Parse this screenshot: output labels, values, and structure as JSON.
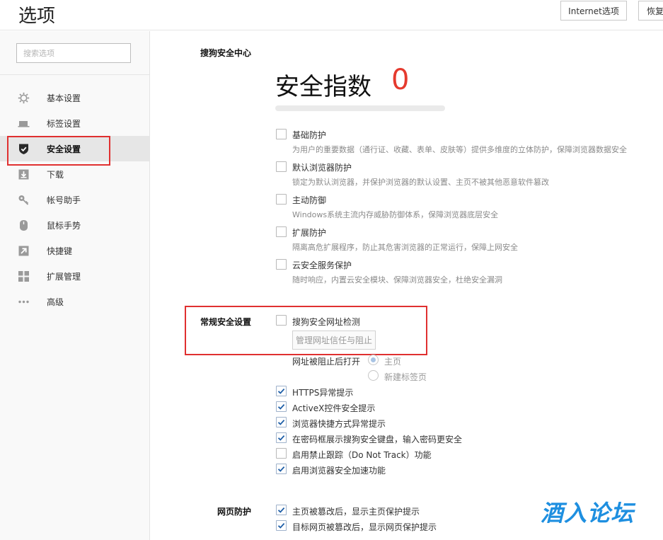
{
  "header": {
    "title": "选项",
    "internet_options": "Internet选项",
    "restore": "恢复"
  },
  "sidebar": {
    "search_placeholder": "搜索选项",
    "items": [
      {
        "label": "基本设置",
        "icon": "gear-icon"
      },
      {
        "label": "标签设置",
        "icon": "tab-icon"
      },
      {
        "label": "安全设置",
        "icon": "shield-icon",
        "active": true
      },
      {
        "label": "下载",
        "icon": "download-icon"
      },
      {
        "label": "帐号助手",
        "icon": "key-icon"
      },
      {
        "label": "鼠标手势",
        "icon": "mouse-icon"
      },
      {
        "label": "快捷键",
        "icon": "shortcut-arrow-icon"
      },
      {
        "label": "扩展管理",
        "icon": "extension-grid-icon"
      },
      {
        "label": "高级",
        "icon": "more-dots-icon"
      }
    ]
  },
  "security_center": {
    "section_title": "搜狗安全中心",
    "index_label": "安全指数",
    "score": "0",
    "score_progress": 0,
    "options": [
      {
        "title": "基础防护",
        "desc": "为用户的重要数据（通行证、收藏、表单、皮肤等）提供多维度的立体防护，保障浏览器数据安全",
        "checked": false
      },
      {
        "title": "默认浏览器防护",
        "desc": "锁定为默认浏览器，并保护浏览器的默认设置、主页不被其他恶意软件篡改",
        "checked": false
      },
      {
        "title": "主动防御",
        "desc": "Windows系统主流内存威胁防御体系，保障浏览器底层安全",
        "checked": false
      },
      {
        "title": "扩展防护",
        "desc": "隔离高危扩展程序，防止其危害浏览器的正常运行，保障上网安全",
        "checked": false
      },
      {
        "title": "云安全服务保护",
        "desc": "随时响应，内置云安全模块、保障浏览器安全，杜绝安全漏洞",
        "checked": false
      }
    ]
  },
  "general_security": {
    "section_title": "常规安全设置",
    "url_check_label": "搜狗安全网址检测",
    "url_check_checked": false,
    "manage_button": "管理网址信任与阻止",
    "blocked_open_label": "网址被阻止后打开",
    "radio_options": [
      {
        "label": "主页",
        "selected": true
      },
      {
        "label": "新建标签页",
        "selected": false
      }
    ],
    "checks": [
      {
        "label": "HTTPS异常提示",
        "checked": true
      },
      {
        "label": "ActiveX控件安全提示",
        "checked": true
      },
      {
        "label": "浏览器快捷方式异常提示",
        "checked": true
      },
      {
        "label": "在密码框展示搜狗安全键盘，输入密码更安全",
        "checked": true
      },
      {
        "label": "启用禁止跟踪（Do Not Track）功能",
        "checked": false
      },
      {
        "label": "启用浏览器安全加速功能",
        "checked": true
      }
    ]
  },
  "web_protection": {
    "section_title": "网页防护",
    "checks": [
      {
        "label": "主页被篡改后，显示主页保护提示",
        "checked": true
      },
      {
        "label": "目标网页被篡改后，显示网页保护提示",
        "checked": true
      }
    ]
  },
  "watermark": "酒入论坛",
  "colors": {
    "accent_red": "#e53a2e",
    "highlight_box": "#e03030",
    "watermark_blue": "#1e8fe0"
  }
}
